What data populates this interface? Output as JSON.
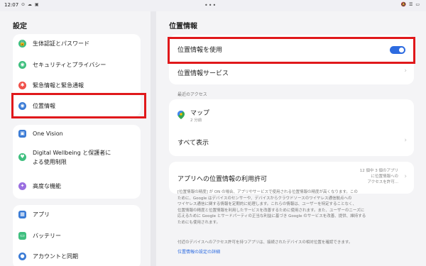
{
  "status": {
    "time": "12:07",
    "left_icons": "⊙ ☁ ▣",
    "dots": "•••",
    "right_icons": "🔕 ☰ ▭"
  },
  "left": {
    "title": "設定",
    "group1": [
      {
        "label": "生体認証とパスワード",
        "icon": "lock-icon",
        "glyph": "🔒",
        "color": "#3fbf7f"
      },
      {
        "label": "セキュリティとプライバシー",
        "icon": "shield-icon",
        "glyph": "◉",
        "color": "#3fbf7f"
      },
      {
        "label": "緊急情報と緊急通報",
        "icon": "asterisk-icon",
        "glyph": "✱",
        "color": "#f0504a"
      },
      {
        "label": "位置情報",
        "icon": "location-pin-icon",
        "glyph": "◉",
        "color": "#3a7bd5"
      }
    ],
    "group2": [
      {
        "label": "One Vision",
        "icon": "one-vision-icon",
        "glyph": "▣",
        "color": "#3a7bd5"
      },
      {
        "label": "Digital Wellbeing と保護者には使用制限",
        "line1": "Digital Wellbeing と保護者に",
        "line2": "よる使用制限",
        "icon": "wellbeing-icon",
        "glyph": "♥",
        "color": "#3fbf7f"
      },
      {
        "label": "高度な機能",
        "icon": "advanced-icon",
        "glyph": "✦",
        "color": "#9a6ee0"
      }
    ],
    "group3": [
      {
        "label": "アプリ",
        "icon": "apps-icon",
        "glyph": "▦",
        "color": "#3a7bd5"
      },
      {
        "label": "バッテリー",
        "icon": "battery-icon",
        "glyph": "▭",
        "color": "#3fbf7f"
      },
      {
        "label": "アカウントと同期",
        "icon": "account-icon",
        "glyph": "●",
        "color": "#3a7bd5"
      }
    ]
  },
  "right": {
    "title": "位置情報",
    "use_location": "位置情報を使用",
    "location_services": "位置情報サービス",
    "recent_caption": "最近のアクセス",
    "recent_app": "マップ",
    "recent_time": "2 分前",
    "show_all": "すべて表示",
    "permission_label": "アプリへの位置情報の利用許可",
    "permission_note_1": "12 個中 3 個のアプリ",
    "permission_note_2": "に位置情報への",
    "permission_note_3": "アクセスを許可...",
    "desc_1": "[位置情報の精度] が ON の場合、アプリやサービスで使用される位置情報の精度が高くなります。この",
    "desc_2": "ために、Google はデバイスのセンサーや、デバイスからクラウドソースのワイヤレス通信拠点への",
    "desc_3": "ワイヤレス通信に関する情報を定期的に処理します。これらの情報は、ユーザーを特定することなく、",
    "desc_4": "位置情報の精度と位置情報を利用したサービスを改善するために使用されます。また、ユーザーのニーズに",
    "desc_5": "応えるために Google とサードパーティの正当な利益に基づき Google のサービスを改善、提供、維持する",
    "desc_6": "ためにも使用されます。",
    "nearby_note": "付近のデバイスへのアクセス許可を持つアプリは、接続されたデバイスの相対位置を確認できます。",
    "settings_link": "位置情報の設定の詳細"
  },
  "colors": {
    "accent": "#2d6be0",
    "highlight": "#e0181b"
  }
}
